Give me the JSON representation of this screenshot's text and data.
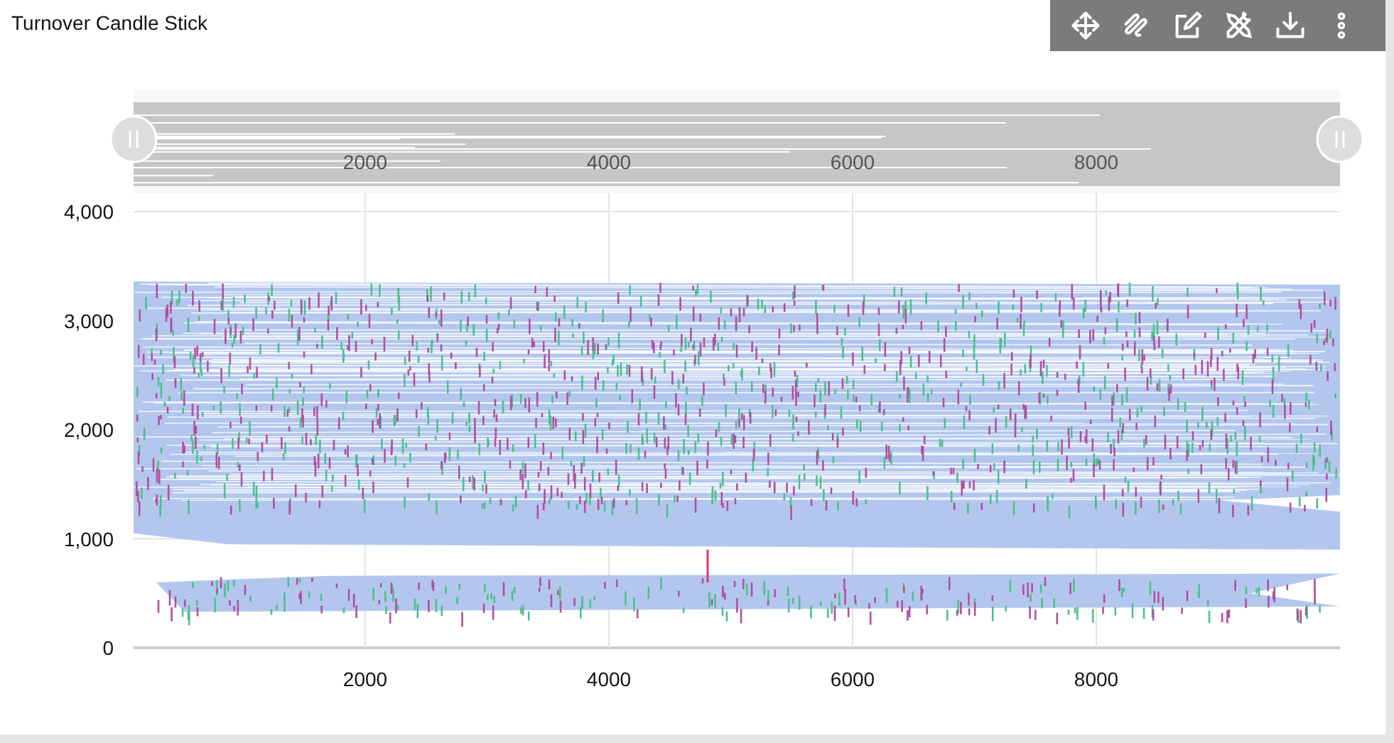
{
  "title": "Turnover Candle Stick",
  "toolbar": {
    "buttons": [
      {
        "kind": "move"
      },
      {
        "kind": "draw"
      },
      {
        "kind": "edit"
      },
      {
        "kind": "tools"
      },
      {
        "kind": "download"
      },
      {
        "kind": "more"
      }
    ]
  },
  "zoom_slider": {
    "level": 1,
    "ticks": [
      "2000",
      "4000",
      "6000",
      "8000"
    ]
  },
  "y_axis": {
    "ticks": [
      "4,000",
      "3,000",
      "2,000",
      "1,000",
      "0"
    ]
  },
  "x_axis": {
    "ticks": [
      "2000",
      "4000",
      "6000",
      "8000"
    ]
  }
}
